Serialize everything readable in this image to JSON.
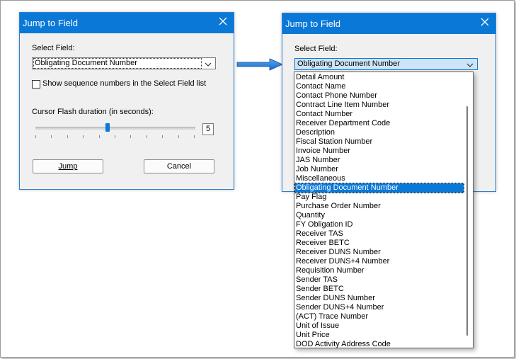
{
  "left_dialog": {
    "title": "Jump to Field",
    "select_label": "Select Field:",
    "selected_value": "Obligating Document Number",
    "checkbox_label": "Show sequence numbers in the Select Field list",
    "slider_label": "Cursor Flash duration (in seconds):",
    "slider_value": "5",
    "slider_level_fraction": 0.44,
    "jump_label": "Jump",
    "cancel_label": "Cancel"
  },
  "right_dialog": {
    "title": "Jump to Field",
    "select_label": "Select Field:",
    "selected_value": "Obligating Document Number",
    "options": [
      "Detail Amount",
      "Contact Name",
      "Contact Phone Number",
      "Contract Line Item Number",
      "Contact Number",
      "Receiver Department Code",
      "Description",
      "Fiscal Station Number",
      "Invoice Number",
      "JAS Number",
      "Job Number",
      "Miscellaneous",
      "Obligating Document Number",
      "Pay Flag",
      "Purchase Order Number",
      "Quantity",
      "FY Obligation ID",
      "Receiver TAS",
      "Receiver BETC",
      "Receiver DUNS Number",
      "Receiver DUNS+4 Number",
      "Requisition Number",
      "Sender TAS",
      "Sender BETC",
      "Sender DUNS Number",
      "Sender DUNS+4 Number",
      "(ACT) Trace Number",
      "Unit of Issue",
      "Unit Price",
      "DOD Activity Address Code"
    ],
    "selected_index": 12
  },
  "icons": {
    "close": "close-icon",
    "dropdown": "chevron-down-icon",
    "arrow": "right-arrow-icon"
  },
  "colors": {
    "titlebar": "#0a78d7",
    "selection": "#0a78d7",
    "dialog_bg": "#f0f0f0"
  }
}
